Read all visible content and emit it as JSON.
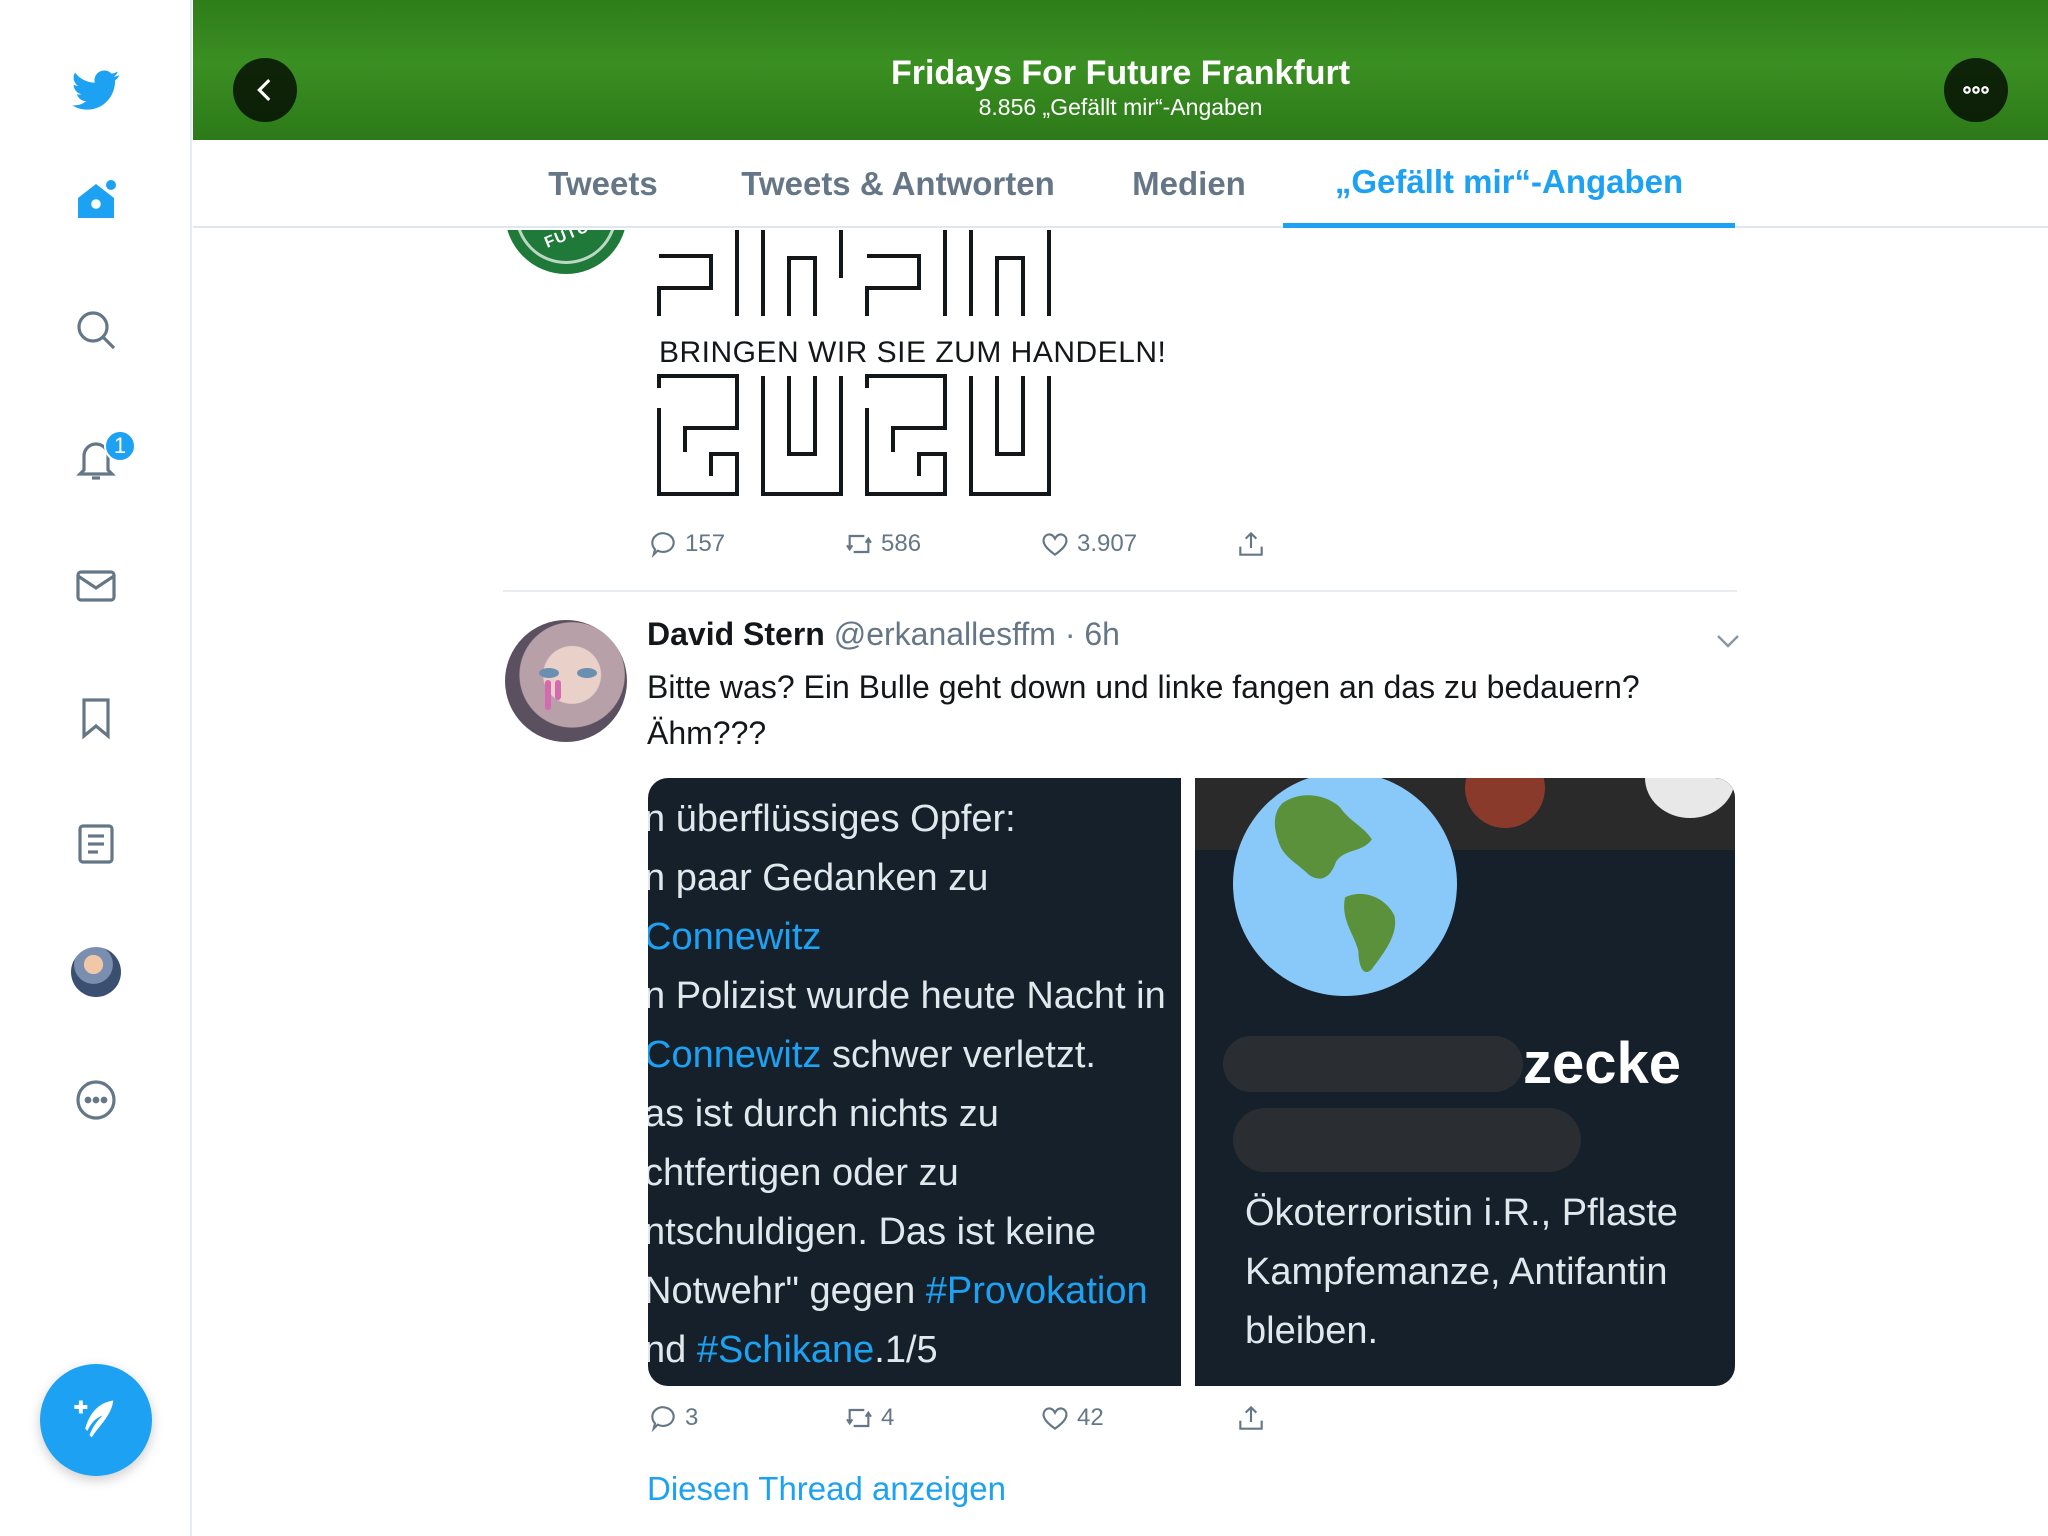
{
  "sidebar": {
    "items": [
      {
        "name": "home-icon"
      },
      {
        "name": "explore-icon"
      },
      {
        "name": "search-icon"
      },
      {
        "name": "notifications-icon",
        "badge": "1"
      },
      {
        "name": "messages-icon"
      },
      {
        "name": "bookmarks-icon"
      },
      {
        "name": "lists-icon"
      },
      {
        "name": "profile-avatar"
      },
      {
        "name": "more-icon"
      }
    ],
    "accent": "#1da1f2"
  },
  "header": {
    "title": "Fridays For Future Frankfurt",
    "subtitle": "8.856 „Gefällt mir“-Angaben",
    "banner_color": "#2e7d1a"
  },
  "tabs": [
    {
      "label": "Tweets"
    },
    {
      "label": "Tweets & Antworten"
    },
    {
      "label": "Medien"
    },
    {
      "label": "„Gefällt mir“-Angaben",
      "active": true
    }
  ],
  "tweet1": {
    "image_caption": "BRINGEN WIR SIE ZUM HANDELN!",
    "logo_text": "FUTURE",
    "replies": "157",
    "retweets": "586",
    "likes": "3.907"
  },
  "tweet2": {
    "name": "David Stern",
    "handle": "@erkanallesffm",
    "separator": "·",
    "time": "6h",
    "text": "Bitte was? Ein Bulle geht down und linke fangen an das zu bedauern? Ähm???",
    "image_left": {
      "l1": "n überflüssiges Opfer:",
      "l2": "n paar Gedanken zu",
      "l3": "Connewitz",
      "l4": "n Polizist wurde heute Nacht in",
      "l5a": "Connewitz",
      "l5b": " schwer verletzt.",
      "l6": "as ist durch nichts zu",
      "l7": "chtfertigen oder zu",
      "l8": "ntschuldigen. Das ist keine",
      "l9a": "Notwehr\" gegen ",
      "l9b": "#Provokation",
      "l10a": "nd ",
      "l10b": "#Schikane",
      "l10c": ".1/5"
    },
    "image_right": {
      "name_fragment": "zecke",
      "bio1": "Ökoterroristin i.R., Pflaste",
      "bio2": "Kampfemanze, Antifantin",
      "bio3": "bleiben."
    },
    "replies": "3",
    "retweets": "4",
    "likes": "42",
    "thread_link": "Diesen Thread anzeigen"
  }
}
